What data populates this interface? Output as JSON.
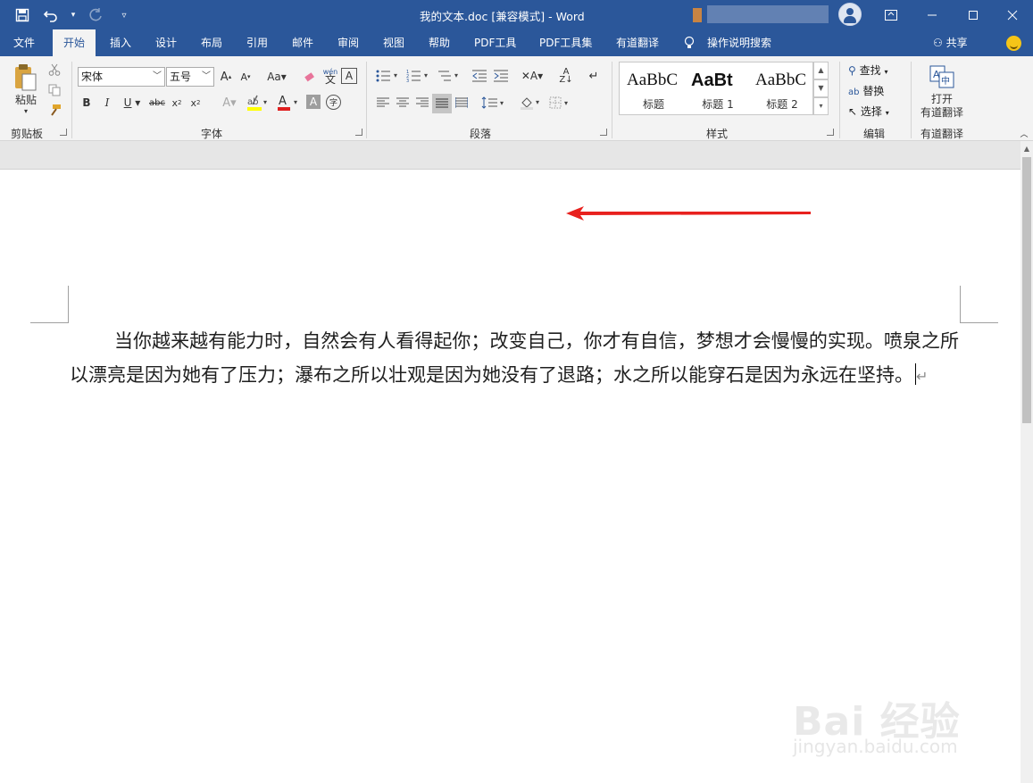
{
  "window": {
    "title": "我的文本.doc [兼容模式]  -  Word",
    "controls": [
      "ribbon-display-icon",
      "minimize-icon",
      "maximize-icon",
      "close-icon"
    ]
  },
  "quick_access": [
    "save-icon",
    "undo-icon",
    "redo-icon",
    "customize-icon"
  ],
  "tabs": [
    {
      "label": "文件"
    },
    {
      "label": "开始"
    },
    {
      "label": "插入"
    },
    {
      "label": "设计"
    },
    {
      "label": "布局"
    },
    {
      "label": "引用"
    },
    {
      "label": "邮件"
    },
    {
      "label": "审阅"
    },
    {
      "label": "视图"
    },
    {
      "label": "帮助"
    },
    {
      "label": "PDF工具"
    },
    {
      "label": "PDF工具集"
    },
    {
      "label": "有道翻译"
    },
    {
      "label": "操作说明搜索"
    }
  ],
  "active_tab": "开始",
  "share_label": "共享",
  "ribbon": {
    "clipboard": {
      "paste_label": "粘贴",
      "group_label": "剪贴板"
    },
    "font": {
      "font_name": "宋体",
      "font_size": "五号",
      "group_label": "字体",
      "font_color": "#e02020",
      "highlight_color": "#ffff00"
    },
    "paragraph": {
      "group_label": "段落"
    },
    "styles": {
      "group_label": "样式",
      "items": [
        {
          "preview": "AaBbC",
          "name": "标题"
        },
        {
          "preview": "AaBt",
          "name": "标题 1"
        },
        {
          "preview": "AaBbC",
          "name": "标题 2"
        }
      ]
    },
    "editing": {
      "find_label": "查找",
      "replace_label": "替换",
      "select_label": "选择",
      "group_label": "编辑"
    },
    "youdao": {
      "open_label_1": "打开",
      "open_label_2": "有道翻译",
      "group_label": "有道翻译"
    }
  },
  "document": {
    "text": "当你越来越有能力时，自然会有人看得起你；改变自己，你才有自信，梦想才会慢慢的实现。喷泉之所以漂亮是因为她有了压力；瀑布之所以壮观是因为她没有了退路；水之所以能穿石是因为永远在坚持。",
    "paragraph_mark": "↵"
  },
  "annotation": {
    "arrow_color": "#e8211e"
  },
  "watermark": {
    "line1": "Bai 经验",
    "line2": "jingyan.baidu.com"
  },
  "colors": {
    "accent": "#2b579a",
    "ribbon_bg": "#f3f3f3"
  }
}
